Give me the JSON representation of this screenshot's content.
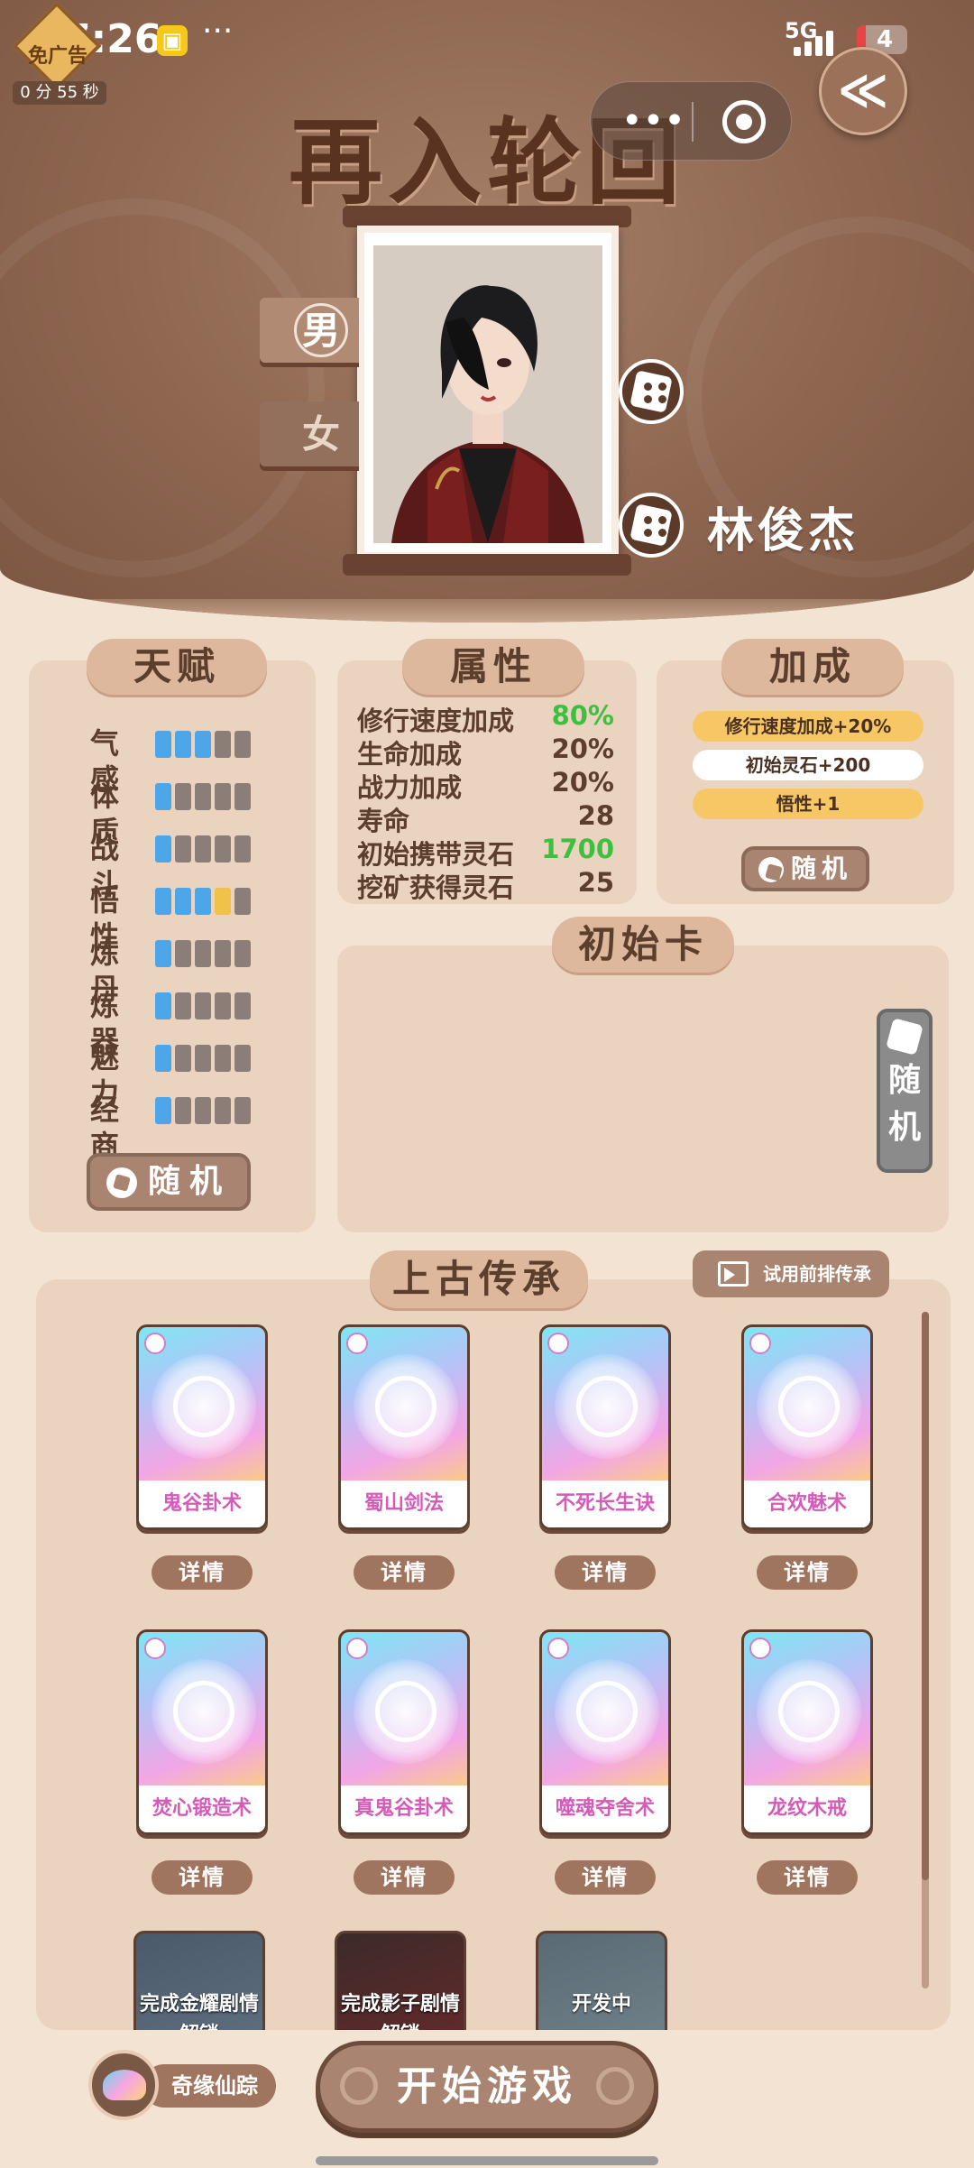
{
  "status_bar": {
    "time": "7:26",
    "dots": "···",
    "network": "5G",
    "battery": "4",
    "app_icon": "app-icon"
  },
  "ad_badge": {
    "label": "免广告",
    "timer": "0 分 55 秒"
  },
  "capsule": {
    "more": "•••"
  },
  "back": {
    "icon": "back-arrow-icon",
    "glyph": "≪"
  },
  "header": {
    "title": "再入轮回",
    "character_name": "林俊杰"
  },
  "gender": {
    "male": "男",
    "female": "女",
    "selected": "male"
  },
  "talent": {
    "title": "天赋",
    "random_label": "随机",
    "filled_color": "#4ca6e8",
    "special_color": "#f0c24a",
    "empty_color": "#8b7e78",
    "items": [
      {
        "label": "气感",
        "level": 3,
        "special": 0
      },
      {
        "label": "体质",
        "level": 1,
        "special": 0
      },
      {
        "label": "战斗",
        "level": 1,
        "special": 0
      },
      {
        "label": "悟性",
        "level": 3,
        "special": 1
      },
      {
        "label": "炼丹",
        "level": 1,
        "special": 0
      },
      {
        "label": "炼器",
        "level": 1,
        "special": 0
      },
      {
        "label": "魅力",
        "level": 1,
        "special": 0
      },
      {
        "label": "经商",
        "level": 1,
        "special": 0
      }
    ]
  },
  "attributes": {
    "title": "属性",
    "rows": [
      {
        "name": "修行速度加成",
        "value": "80%",
        "color": "#3fbf3f"
      },
      {
        "name": "生命加成",
        "value": "20%",
        "color": "#5b3e2c"
      },
      {
        "name": "战力加成",
        "value": "20%",
        "color": "#5b3e2c"
      },
      {
        "name": "寿命",
        "value": "28",
        "color": "#5b3e2c"
      },
      {
        "name": "初始携带灵石",
        "value": "1700",
        "color": "#3fbf3f"
      },
      {
        "name": "挖矿获得灵石",
        "value": "25",
        "color": "#5b3e2c"
      }
    ]
  },
  "bonus": {
    "title": "加成",
    "random_label": "随机",
    "items": [
      {
        "label": "修行速度加成+20%",
        "color": "#f7c766"
      },
      {
        "label": "初始灵石+200",
        "color": "#ffffff"
      },
      {
        "label": "悟性+1",
        "color": "#f7c766"
      }
    ]
  },
  "initial_card": {
    "title": "初始卡",
    "random_label_1": "随",
    "random_label_2": "机"
  },
  "heritage": {
    "title": "上古传承",
    "trial_label": "试用前排传承",
    "detail_label": "详情",
    "cards": [
      {
        "name": "鬼谷卦术",
        "icon": "turtle-shell-icon"
      },
      {
        "name": "蜀山剑法",
        "icon": "crossed-swords-icon"
      },
      {
        "name": "不死长生诀",
        "icon": "book-icon"
      },
      {
        "name": "合欢魅术",
        "icon": "fox-fan-icon"
      },
      {
        "name": "焚心锻造术",
        "icon": "flame-anvil-icon"
      },
      {
        "name": "真鬼谷卦术",
        "icon": "turtle-shell-icon"
      },
      {
        "name": "噬魂夺舍术",
        "icon": "ghost-flames-icon"
      },
      {
        "name": "龙纹木戒",
        "icon": "dragon-ring-icon"
      }
    ],
    "locked": [
      {
        "line1": "完成金耀剧情",
        "line2": "解锁"
      },
      {
        "line1": "完成影子剧情",
        "line2": "解锁"
      },
      {
        "line1": "开发中",
        "line2": ""
      }
    ]
  },
  "footer": {
    "adventure_label": "奇缘仙踪",
    "start_label": "开始游戏"
  }
}
